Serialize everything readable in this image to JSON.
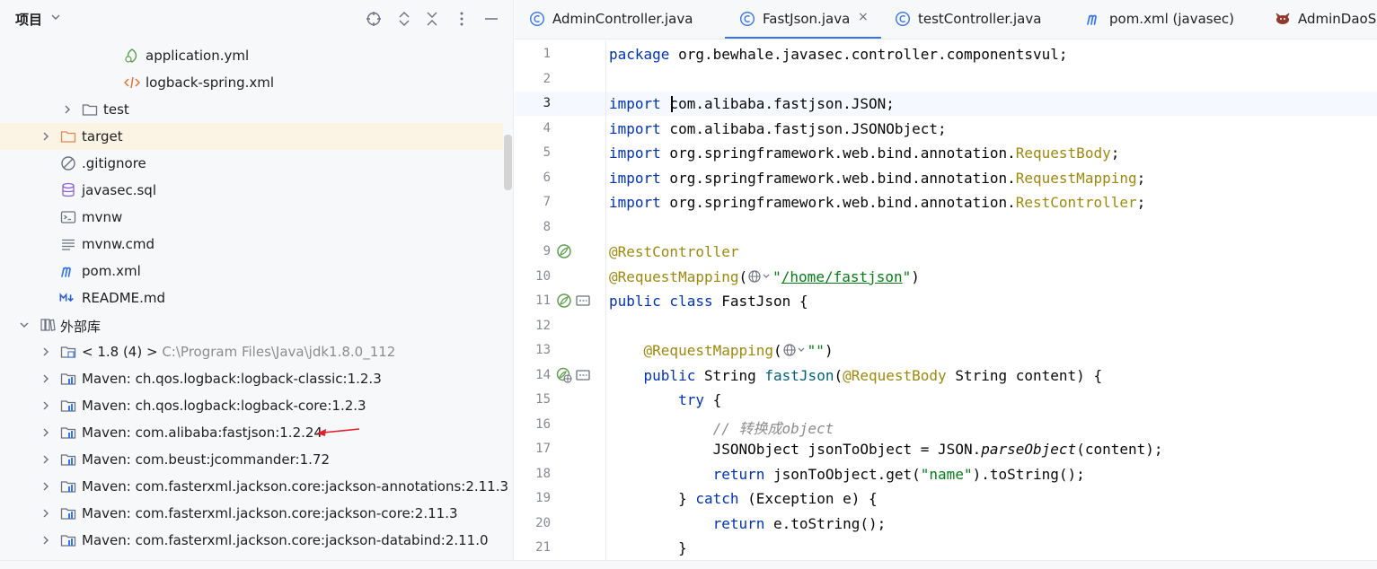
{
  "project_panel": {
    "title": "项目",
    "header_icons": [
      "crosshair-icon",
      "expand-icon",
      "collapse-icon",
      "more-vert-icon",
      "minimize-icon"
    ],
    "tree": [
      {
        "label": "application.yml",
        "icon": "yaml-icon"
      },
      {
        "label": "logback-spring.xml",
        "icon": "xml-icon"
      },
      {
        "label": "test",
        "icon": "folder-icon"
      },
      {
        "label": "target",
        "icon": "folder-orange-icon"
      },
      {
        "label": ".gitignore",
        "icon": "ignore-icon"
      },
      {
        "label": "javasec.sql",
        "icon": "database-icon"
      },
      {
        "label": "mvnw",
        "icon": "terminal-icon"
      },
      {
        "label": "mvnw.cmd",
        "icon": "text-file-icon"
      },
      {
        "label": "pom.xml",
        "icon": "maven-icon"
      },
      {
        "label": "README.md",
        "icon": "markdown-icon"
      },
      {
        "label": "外部库",
        "icon": "library-icon"
      },
      {
        "label": "< 1.8 (4) >",
        "path": "C:\\Program Files\\Java\\jdk1.8.0_112",
        "icon": "jdk-icon"
      },
      {
        "label": "Maven: ch.qos.logback:logback-classic:1.2.3",
        "icon": "maven-lib-icon"
      },
      {
        "label": "Maven: ch.qos.logback:logback-core:1.2.3",
        "icon": "maven-lib-icon"
      },
      {
        "label": "Maven: com.alibaba:fastjson:1.2.24",
        "icon": "maven-lib-icon"
      },
      {
        "label": "Maven: com.beust:jcommander:1.72",
        "icon": "maven-lib-icon"
      },
      {
        "label": "Maven: com.fasterxml.jackson.core:jackson-annotations:2.11.3",
        "icon": "maven-lib-icon"
      },
      {
        "label": "Maven: com.fasterxml.jackson.core:jackson-core:2.11.3",
        "icon": "maven-lib-icon"
      },
      {
        "label": "Maven: com.fasterxml.jackson.core:jackson-databind:2.11.0",
        "icon": "maven-lib-icon"
      }
    ]
  },
  "tabs": [
    {
      "label": "AdminController.java",
      "icon": "java-class-icon"
    },
    {
      "label": "FastJson.java",
      "icon": "java-class-icon",
      "active": true,
      "close": "×"
    },
    {
      "label": "testController.java",
      "icon": "java-class-icon"
    },
    {
      "label": "pom.xml (javasec)",
      "icon": "maven-icon"
    },
    {
      "label": "AdminDaoS",
      "icon": "mybatis-icon"
    }
  ],
  "editor": {
    "current_line": 3,
    "line_numbers": [
      "1",
      "2",
      "3",
      "4",
      "5",
      "6",
      "7",
      "8",
      "9",
      "10",
      "11",
      "12",
      "13",
      "14",
      "15",
      "16",
      "17",
      "18",
      "19",
      "20",
      "21"
    ],
    "code": {
      "l1_kw": "package",
      "l1_rest": " org.bewhale.javasec.controller.componentsvul;",
      "l3_kw": "import",
      "l3_rest": " com.alibaba.fastjson.JSON;",
      "l4_kw": "import",
      "l4_rest": " com.alibaba.fastjson.JSONObject;",
      "l5_kw": "import",
      "l5_rest": " org.springframework.web.bind.annotation.",
      "l5_ann": "RequestBody",
      "l5_end": ";",
      "l6_kw": "import",
      "l6_rest": " org.springframework.web.bind.annotation.",
      "l6_ann": "RequestMapping",
      "l6_end": ";",
      "l7_kw": "import",
      "l7_rest": " org.springframework.web.bind.annotation.",
      "l7_ann": "RestController",
      "l7_end": ";",
      "l9_ann": "@RestController",
      "l10_ann": "@RequestMapping",
      "l10_open": "(",
      "l10_q1": "\"",
      "l10_str": "/home/fastjson",
      "l10_q2": "\"",
      "l10_close": ")",
      "l11_kw": "public class",
      "l11_rest": " FastJson {",
      "l13_indent": "    ",
      "l13_ann": "@RequestMapping",
      "l13_open": "(",
      "l13_str": "\"\"",
      "l13_close": ")",
      "l14_indent": "    ",
      "l14_kw": "public",
      "l14_type": " String ",
      "l14_fn": "fastJson",
      "l14_open": "(",
      "l14_ann": "@RequestBody",
      "l14_rest": " String content) {",
      "l15_indent": "        ",
      "l15_kw": "try",
      "l15_rest": " {",
      "l16_indent": "            ",
      "l16_cm": "// 转换成object",
      "l17_indent": "            ",
      "l17_a": "JSONObject jsonToObject = JSON.",
      "l17_it": "parseObject",
      "l17_b": "(content);",
      "l18_indent": "            ",
      "l18_kw": "return",
      "l18_a": " jsonToObject.get(",
      "l18_str": "\"name\"",
      "l18_b": ").toString();",
      "l19_indent": "        ",
      "l19_a": "} ",
      "l19_kw": "catch",
      "l19_b": " (Exception e) {",
      "l20_indent": "            ",
      "l20_kw": "return",
      "l20_b": " e.toString();",
      "l21_indent": "        ",
      "l21_a": "}"
    }
  },
  "colors": {
    "keyword": "#0033b3",
    "annotation": "#9e880d",
    "string": "#067d17",
    "method": "#00627a",
    "comment": "#8c8c8c",
    "selection_row": "#fbf4e4",
    "tab_underline": "#3574f0",
    "arrow": "#e0202a"
  }
}
